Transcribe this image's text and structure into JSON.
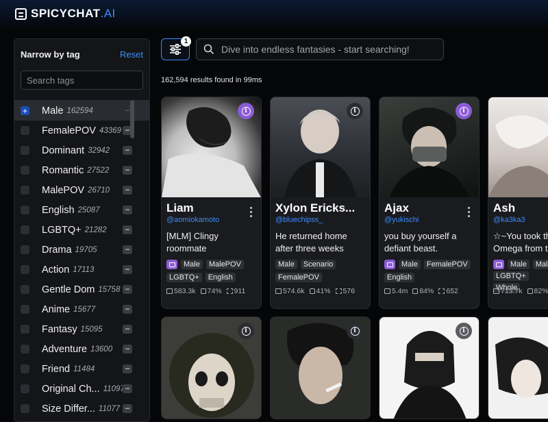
{
  "brand": {
    "name": "SPICYCHAT",
    "suffix": ".AI"
  },
  "sidebar": {
    "title": "Narrow by tag",
    "reset": "Reset",
    "search_placeholder": "Search tags",
    "tags": [
      {
        "name": "Male",
        "count": "162594",
        "state": "added"
      },
      {
        "name": "FemalePOV",
        "count": "43369"
      },
      {
        "name": "Dominant",
        "count": "32942"
      },
      {
        "name": "Romantic",
        "count": "27522"
      },
      {
        "name": "MalePOV",
        "count": "26710"
      },
      {
        "name": "English",
        "count": "25087"
      },
      {
        "name": "LGBTQ+",
        "count": "21282"
      },
      {
        "name": "Drama",
        "count": "19705"
      },
      {
        "name": "Action",
        "count": "17113"
      },
      {
        "name": "Gentle Dom",
        "count": "15758"
      },
      {
        "name": "Anime",
        "count": "15677"
      },
      {
        "name": "Fantasy",
        "count": "15095"
      },
      {
        "name": "Adventure",
        "count": "13600"
      },
      {
        "name": "Friend",
        "count": "11484"
      },
      {
        "name": "Original Ch...",
        "count": "11097"
      },
      {
        "name": "Size Differ...",
        "count": "11077"
      }
    ]
  },
  "filter": {
    "badge": "1"
  },
  "search": {
    "placeholder": "Dive into endless fantasies - start searching!"
  },
  "results_text": "162,594 results found in 99ms",
  "cards": [
    {
      "name": "Liam",
      "handle": "@aomiokamoto",
      "desc": "[MLM] Clingy roommate",
      "tags": [
        "Male",
        "MalePOV",
        "LGBTQ+",
        "English"
      ],
      "has_image_chip": true,
      "messages": "583.3k",
      "likes": "74%",
      "bots": "911",
      "info_style": "purple"
    },
    {
      "name": "Xylon Ericks...",
      "handle": "@bluechipss_",
      "desc": "He returned home after three weeks",
      "tags": [
        "Male",
        "Scenario",
        "FemalePOV"
      ],
      "has_image_chip": false,
      "messages": "574.6k",
      "likes": "41%",
      "bots": "576",
      "info_style": "dark"
    },
    {
      "name": "Ajax",
      "handle": "@yukischi",
      "desc": "you buy yourself a defiant beast.",
      "tags": [
        "Male",
        "FemalePOV",
        "English"
      ],
      "has_image_chip": true,
      "messages": "5.4m",
      "likes": "84%",
      "bots": "652",
      "info_style": "purple"
    },
    {
      "name": "Ash",
      "handle": "@ka3ka3",
      "desc": "☆~You took th Omega from th",
      "tags": [
        "Male",
        "Male",
        "LGBTQ+",
        "Whole"
      ],
      "has_image_chip": true,
      "messages": "713.7k",
      "likes": "82%",
      "bots": "",
      "info_style": "none"
    }
  ],
  "icons": {
    "filter": "sliders-icon",
    "search": "search-icon",
    "info": "info-icon",
    "more": "kebab-icon",
    "messages": "chat-icon",
    "likes": "thumbs-up-icon",
    "bots": "bots-icon"
  },
  "colors": {
    "accent": "#3b8cff",
    "purple": "#8b5cd6",
    "bg": "#050608",
    "card": "#1a1b1f"
  }
}
